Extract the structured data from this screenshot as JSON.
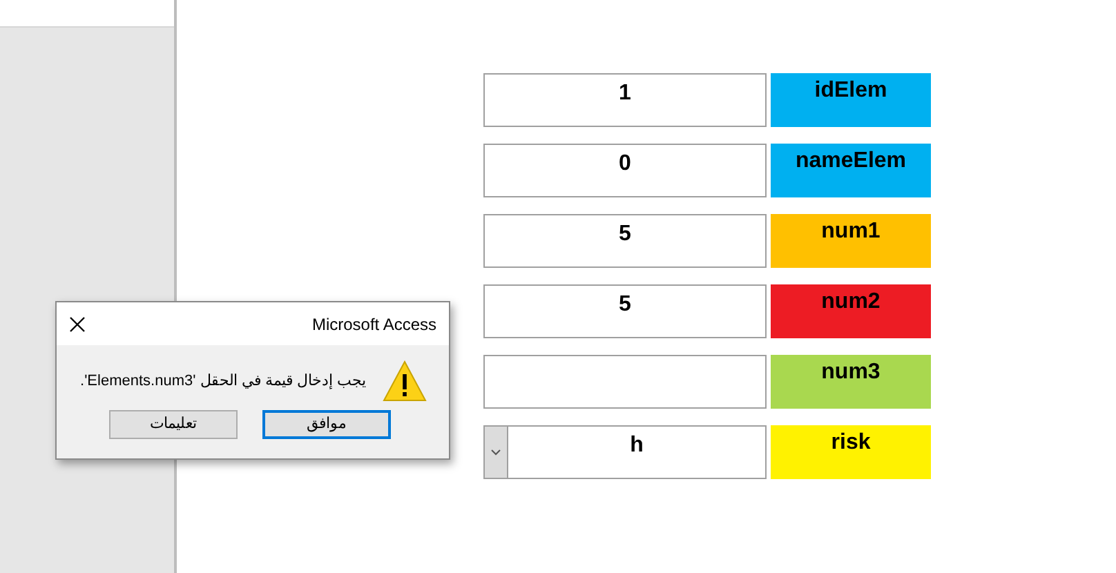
{
  "form": {
    "fields": [
      {
        "kind": "text",
        "value": "1",
        "label": "idElem",
        "color": "#00b0f0"
      },
      {
        "kind": "text",
        "value": "0",
        "label": "nameElem",
        "color": "#00b0f0"
      },
      {
        "kind": "text",
        "value": "5",
        "label": "num1",
        "color": "#ffc000"
      },
      {
        "kind": "text",
        "value": "5",
        "label": "num2",
        "color": "#ed1c24"
      },
      {
        "kind": "text",
        "label": "num3",
        "color": "#a9d84f"
      },
      {
        "kind": "combo",
        "value": "h",
        "label": "risk",
        "color": "#fff200"
      }
    ]
  },
  "dialog": {
    "title": "Microsoft Access",
    "message": "يجب إدخال قيمة في الحقل 'Elements.num3'.",
    "buttons": [
      {
        "label": "موافق",
        "selected": true
      },
      {
        "label": "تعليمات",
        "selected": false
      }
    ]
  }
}
